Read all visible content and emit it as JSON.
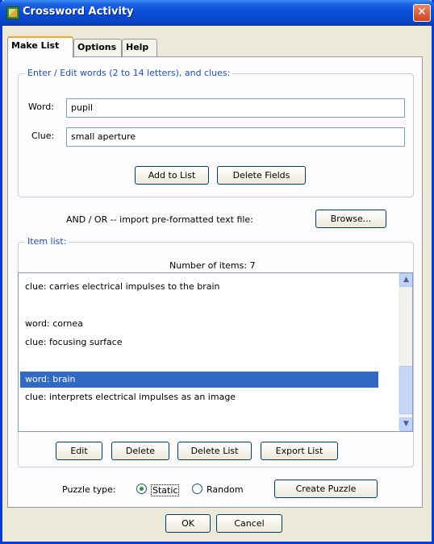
{
  "window": {
    "title": "Crossword Activity",
    "close_symbol": "✕"
  },
  "tabs": [
    {
      "label": "Make List",
      "active": true
    },
    {
      "label": "Options",
      "active": false
    },
    {
      "label": "Help",
      "active": false
    }
  ],
  "entry_group": {
    "legend": "Enter / Edit words (2 to 14 letters), and clues:",
    "word_label": "Word:",
    "word_value": "pupil",
    "clue_label": "Clue:",
    "clue_value": "small aperture",
    "add_button": "Add to List",
    "delete_fields_button": "Delete Fields"
  },
  "import": {
    "text": "AND / OR -- import pre-formatted text file:",
    "browse_button": "Browse..."
  },
  "item_list": {
    "legend": "Item list:",
    "count_text": "Number of items: 7",
    "lines": [
      {
        "text": "clue: carries electrical impulses to the brain",
        "selected": false
      },
      {
        "text": "",
        "selected": false
      },
      {
        "text": "word: cornea",
        "selected": false
      },
      {
        "text": "clue: focusing surface",
        "selected": false
      },
      {
        "text": "",
        "selected": false
      },
      {
        "text": "word: brain",
        "selected": true
      },
      {
        "text": "clue: interprets electrical impulses as an image",
        "selected": false
      }
    ],
    "edit_button": "Edit",
    "delete_button": "Delete",
    "delete_list_button": "Delete List",
    "export_button": "Export List"
  },
  "puzzle": {
    "label": "Puzzle type:",
    "static_label": "Static",
    "random_label": "Random",
    "selected": "Static",
    "create_button": "Create Puzzle"
  },
  "footer": {
    "ok_button": "OK",
    "cancel_button": "Cancel"
  },
  "colors": {
    "title_bar": "#0a4ed8",
    "selection": "#316ac5",
    "legend_text": "#1e4fc2",
    "close_button": "#d0411a"
  }
}
